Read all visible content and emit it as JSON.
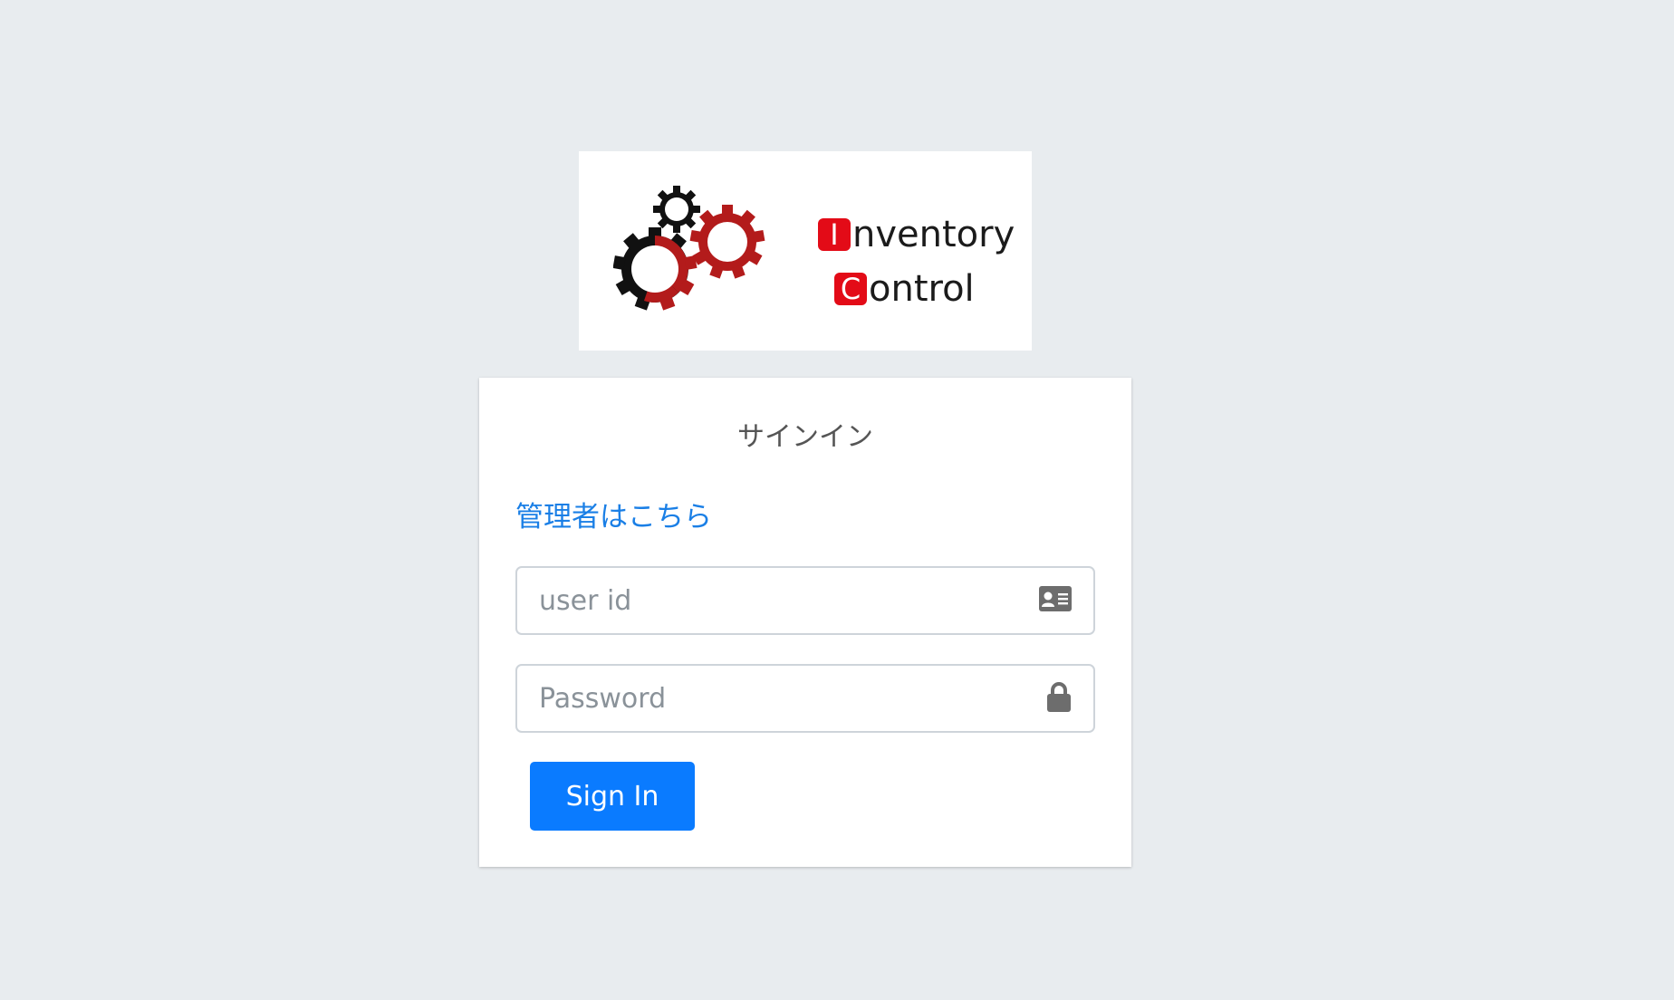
{
  "logo": {
    "line1_initial": "I",
    "line1_rest": "nventory",
    "line2_initial": "C",
    "line2_rest": "ontrol",
    "initial_color": "#e30b17"
  },
  "signin": {
    "title": "サインイン",
    "admin_link": "管理者はこちら",
    "userid": {
      "placeholder": "user id",
      "value": "",
      "icon": "id-card-icon"
    },
    "password": {
      "placeholder": "Password",
      "value": "",
      "icon": "lock-icon"
    },
    "button_label": "Sign In"
  },
  "colors": {
    "background": "#e8ecef",
    "accent": "#0a7bff",
    "link": "#1a7fe6"
  }
}
